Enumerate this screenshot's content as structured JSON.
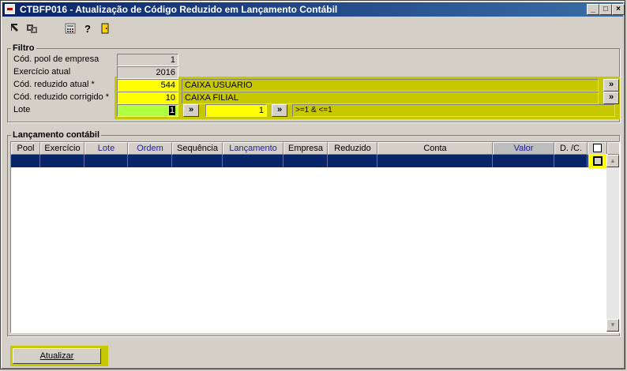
{
  "window": {
    "title": "CTBFP016 - Atualização de Código Reduzido em Lançamento Contábil",
    "controls": [
      "_",
      "□",
      "×"
    ]
  },
  "toolbar": {
    "icons": [
      "arrow-icon",
      "link-icon",
      "calculator-icon",
      "help-icon",
      "exit-icon"
    ]
  },
  "filtro": {
    "legend": "Filtro",
    "pool_label": "Cód. pool de empresa",
    "pool_value": "1",
    "exercicio_label": "Exercício atual",
    "exercicio_value": "2016",
    "reduzido_atual_label": "Cód. reduzido atual *",
    "reduzido_atual_value": "544",
    "reduzido_atual_desc": "CAIXA USUARIO",
    "reduzido_corrigido_label": "Cód. reduzido corrigido *",
    "reduzido_corrigido_value": "10",
    "reduzido_corrigido_desc": "CAIXA FILIAL",
    "lote_label": "Lote",
    "lote_from": "1",
    "lote_to": "1",
    "lote_expr": ">=1 & <=1",
    "lookup_label": "»"
  },
  "lancamento": {
    "legend": "Lançamento contábil",
    "columns": [
      "Pool",
      "Exercício",
      "Lote",
      "Ordem",
      "Sequência",
      "Lançamento",
      "Empresa",
      "Reduzido",
      "Conta",
      "Valor",
      "D. /C."
    ],
    "rows": []
  },
  "actions": {
    "atualizar_label": "Atualizar"
  },
  "colors": {
    "title_bar": "#0a246a",
    "highlight": "#c8c800",
    "required_field": "#ffff00",
    "focus_field": "#b0ff40",
    "selected_row": "#0a246a"
  }
}
